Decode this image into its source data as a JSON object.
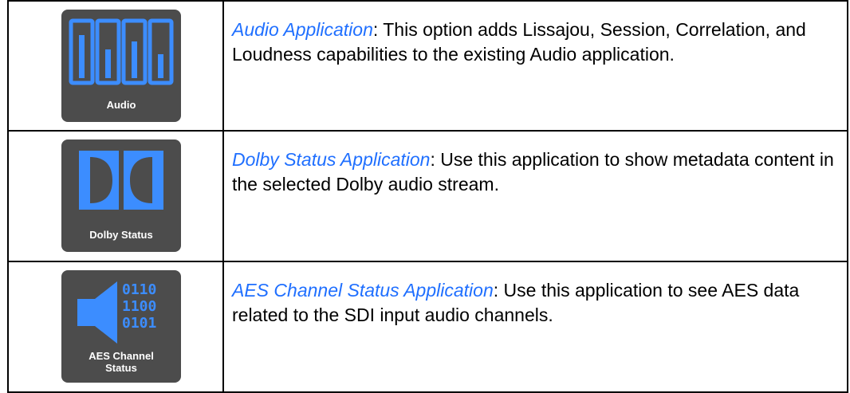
{
  "colors": {
    "accent": "#3c8dff",
    "tile_bg": "#4c4c4c",
    "link": "#1f6fff"
  },
  "rows": [
    {
      "icon": {
        "name": "audio-meter-icon",
        "label": "Audio"
      },
      "link": "Audio Application",
      "text": ": This option adds Lissajou, Session, Correlation, and Loudness capabilities to the existing Audio application."
    },
    {
      "icon": {
        "name": "dolby-logo-icon",
        "label": "Dolby Status"
      },
      "link": "Dolby Status Application",
      "text": ": Use this application to show metadata content in the selected Dolby audio stream."
    },
    {
      "icon": {
        "name": "aes-channel-status-icon",
        "label": "AES Channel Status",
        "binary": [
          "0110",
          "1100",
          "0101"
        ]
      },
      "link": "AES Channel Status Application",
      "text": ": Use this application to see AES data related to the SDI input audio channels."
    }
  ]
}
